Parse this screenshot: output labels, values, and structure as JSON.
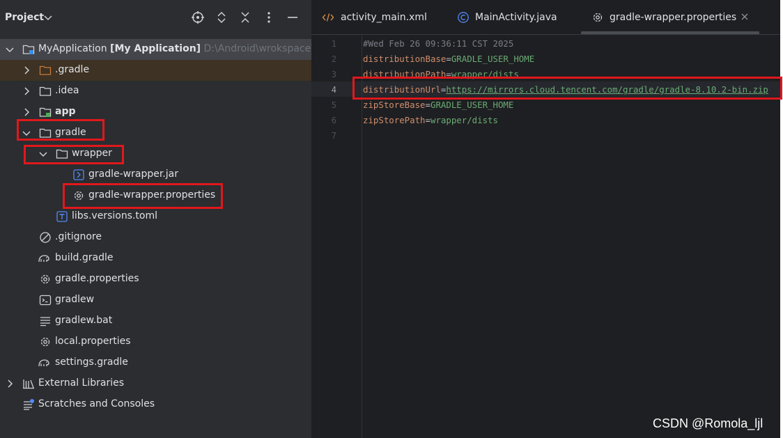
{
  "project_panel": {
    "title": "Project",
    "tree": {
      "root": {
        "name": "MyApplication",
        "module": "[My Application]",
        "path": "D:\\Android\\wrokspace\\M"
      },
      "items": [
        {
          "label": ".gradle",
          "icon": "folder-orange-icon"
        },
        {
          "label": ".idea",
          "icon": "folder-icon"
        },
        {
          "label": "app",
          "icon": "module-folder-icon"
        },
        {
          "label": "gradle",
          "icon": "folder-icon"
        },
        {
          "label": "wrapper",
          "icon": "folder-icon"
        },
        {
          "label": "gradle-wrapper.jar",
          "icon": "jar-icon"
        },
        {
          "label": "gradle-wrapper.properties",
          "icon": "gear-icon"
        },
        {
          "label": "libs.versions.toml",
          "icon": "toml-icon"
        },
        {
          "label": ".gitignore",
          "icon": "ignore-icon"
        },
        {
          "label": "build.gradle",
          "icon": "gradle-elephant-icon"
        },
        {
          "label": "gradle.properties",
          "icon": "gear-icon"
        },
        {
          "label": "gradlew",
          "icon": "terminal-icon"
        },
        {
          "label": "gradlew.bat",
          "icon": "text-lines-icon"
        },
        {
          "label": "local.properties",
          "icon": "gear-icon"
        },
        {
          "label": "settings.gradle",
          "icon": "gradle-elephant-icon"
        },
        {
          "label": "External Libraries",
          "icon": "library-icon"
        },
        {
          "label": "Scratches and Consoles",
          "icon": "scratches-icon"
        }
      ]
    }
  },
  "editor": {
    "tabs": [
      {
        "label": "activity_main.xml",
        "icon": "xml-icon"
      },
      {
        "label": "MainActivity.java",
        "icon": "java-class-icon"
      },
      {
        "label": "gradle-wrapper.properties",
        "icon": "gear-icon",
        "active": true
      }
    ],
    "line_numbers": [
      "1",
      "2",
      "3",
      "4",
      "5",
      "6",
      "7"
    ],
    "lines": [
      {
        "comment": "#Wed Feb 26 09:36:11 CST 2025"
      },
      {
        "key": "distributionBase",
        "eq": "=",
        "value": "GRADLE_USER_HOME"
      },
      {
        "key": "distributionPath",
        "eq": "=",
        "value": "wrapper/dists"
      },
      {
        "key": "distributionUrl",
        "eq": "=",
        "value": "https://mirrors.cloud.tencent.com/gradle/gradle-8.10.2-bin.zip"
      },
      {
        "key": "zipStoreBase",
        "eq": "=",
        "value": "GRADLE_USER_HOME"
      },
      {
        "key": "zipStorePath",
        "eq": "=",
        "value": "wrapper/dists"
      }
    ]
  },
  "watermark": "CSDN @Romola_ljl",
  "colors": {
    "panel_bg": "#2b2d30",
    "editor_bg": "#1e1f22",
    "annotation_red": "#e0181c",
    "key_color": "#cf8e6d",
    "value_color": "#6aab73"
  }
}
